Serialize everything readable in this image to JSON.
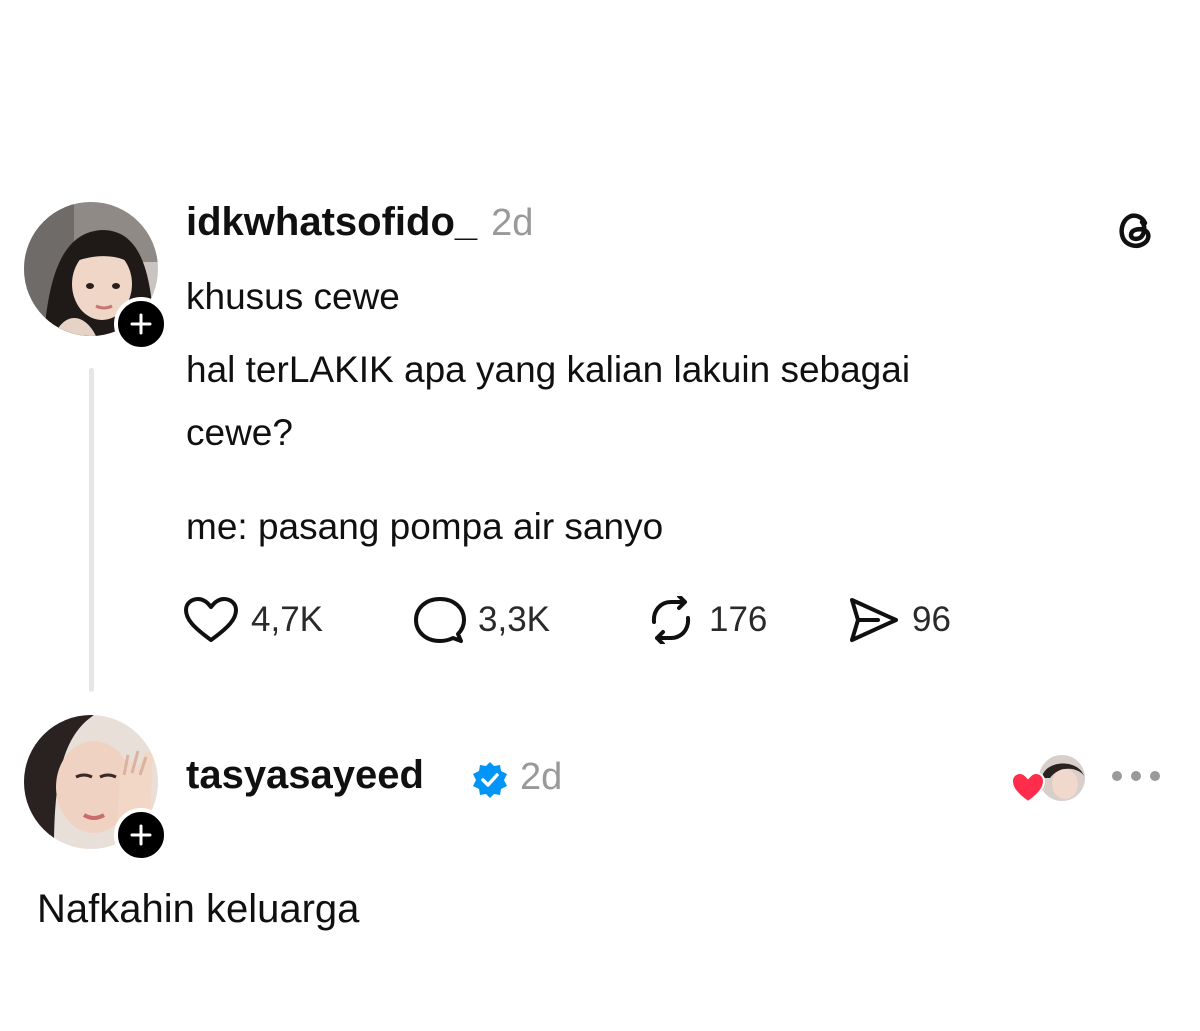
{
  "post": {
    "username": "idkwhatsofido_",
    "time": "2d",
    "lines": [
      "khusus cewe",
      "hal terLAKIK apa yang kalian lakuin sebagai",
      "cewe?",
      "me: pasang pompa air sanyo"
    ],
    "actions": {
      "likes": "4,7K",
      "replies": "3,3K",
      "reposts": "176",
      "shares": "96"
    },
    "icons": [
      "avatar",
      "follow-plus-icon",
      "threads-logo-icon",
      "heart-icon",
      "comment-icon",
      "repost-icon",
      "share-icon"
    ]
  },
  "reply": {
    "username": "tasyasayeed",
    "time": "2d",
    "text": "Nafkahin keluarga",
    "icons": [
      "avatar",
      "follow-plus-icon",
      "verified-badge-icon",
      "liked-by-author-icon",
      "more-options-icon"
    ]
  },
  "colors": {
    "text": "#101010",
    "muted": "#999999",
    "verified": "#0095f6",
    "heart_red": "#ff2d4b",
    "thread_line": "#e6e6e6"
  }
}
